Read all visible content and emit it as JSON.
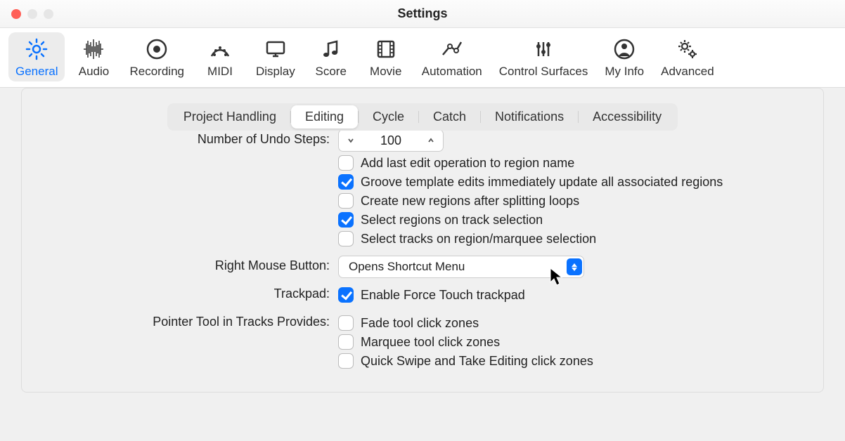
{
  "window": {
    "title": "Settings"
  },
  "toolbar": [
    {
      "name": "general",
      "label": "General",
      "icon": "gear",
      "active": true
    },
    {
      "name": "audio",
      "label": "Audio",
      "icon": "wave"
    },
    {
      "name": "recording",
      "label": "Recording",
      "icon": "record"
    },
    {
      "name": "midi",
      "label": "MIDI",
      "icon": "midi-face"
    },
    {
      "name": "display",
      "label": "Display",
      "icon": "monitor"
    },
    {
      "name": "score",
      "label": "Score",
      "icon": "notes"
    },
    {
      "name": "movie",
      "label": "Movie",
      "icon": "filmstrip"
    },
    {
      "name": "automation",
      "label": "Automation",
      "icon": "curve"
    },
    {
      "name": "control-surfaces",
      "label": "Control Surfaces",
      "icon": "sliders"
    },
    {
      "name": "my-info",
      "label": "My Info",
      "icon": "person"
    },
    {
      "name": "advanced",
      "label": "Advanced",
      "icon": "gears"
    }
  ],
  "subtabs": {
    "items": [
      "Project Handling",
      "Editing",
      "Cycle",
      "Catch",
      "Notifications",
      "Accessibility"
    ],
    "selected": "Editing"
  },
  "form": {
    "undo_label": "Number of Undo Steps:",
    "undo_value": "100",
    "checks1": [
      {
        "label": "Add last edit operation to region name",
        "checked": false
      },
      {
        "label": "Groove template edits immediately update all associated regions",
        "checked": true
      },
      {
        "label": "Create new regions after splitting loops",
        "checked": false
      },
      {
        "label": "Select regions on track selection",
        "checked": true
      },
      {
        "label": "Select tracks on region/marquee selection",
        "checked": false
      }
    ],
    "rmb_label": "Right Mouse Button:",
    "rmb_value": "Opens Shortcut Menu",
    "trackpad_label": "Trackpad:",
    "trackpad_check": {
      "label": "Enable Force Touch trackpad",
      "checked": true
    },
    "pointer_label": "Pointer Tool in Tracks Provides:",
    "pointer_checks": [
      {
        "label": "Fade tool click zones",
        "checked": false
      },
      {
        "label": "Marquee tool click zones",
        "checked": false
      },
      {
        "label": "Quick Swipe and Take Editing click zones",
        "checked": false
      }
    ]
  }
}
